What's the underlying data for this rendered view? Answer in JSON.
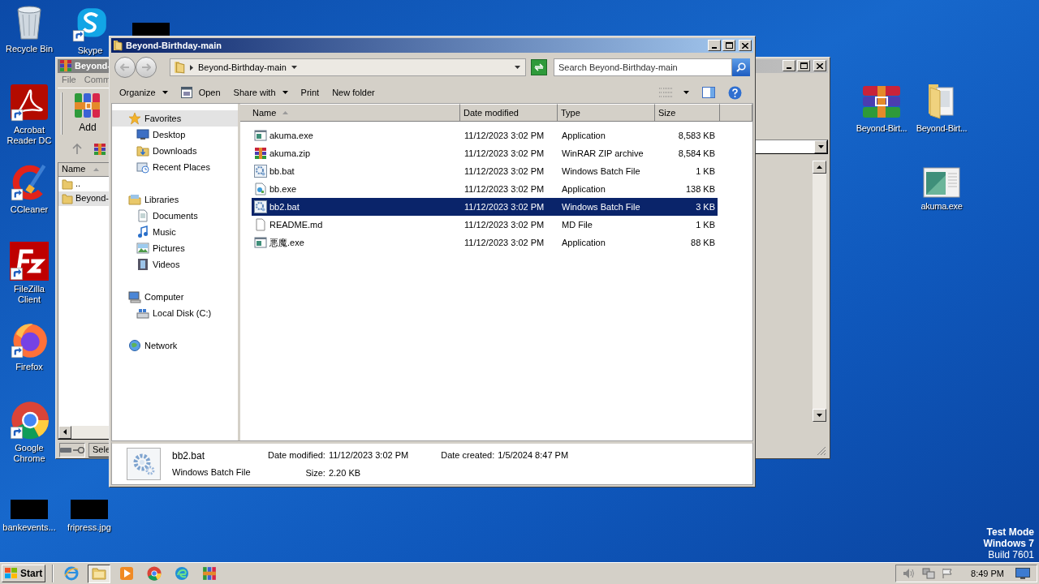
{
  "desktop_icons": [
    {
      "label": "Recycle Bin",
      "kind": "recycle"
    },
    {
      "label": "Skype",
      "kind": "skype"
    },
    {
      "kind": "redacted"
    },
    {
      "label": "Acrobat Reader DC",
      "kind": "acrobat"
    },
    {
      "label": "CCleaner",
      "kind": "ccleaner"
    },
    {
      "label": "FileZilla Client",
      "kind": "filezilla"
    },
    {
      "label": "Firefox",
      "kind": "firefox"
    },
    {
      "label": "Google Chrome",
      "kind": "chrome"
    },
    {
      "label": "bankevents...",
      "kind": "redacted"
    },
    {
      "label": "fripress.jpg",
      "kind": "redacted"
    },
    {
      "label": "Beyond-Birt...",
      "kind": "winrar"
    },
    {
      "label": "Beyond-Birt...",
      "kind": "folder"
    },
    {
      "label": "akuma.exe",
      "kind": "app"
    }
  ],
  "archive_window": {
    "title": "Beyond-",
    "menu": [
      "File",
      "Comm"
    ],
    "tool": "Add",
    "column": "Name",
    "rows": [
      {
        "name": "..",
        "selected": false
      },
      {
        "name": "Beyond-",
        "selected": true
      }
    ],
    "status": "Sele"
  },
  "explorer": {
    "title": "Beyond-Birthday-main",
    "breadcrumb": "Beyond-Birthday-main",
    "search": {
      "placeholder": "Search Beyond-Birthday-main"
    },
    "commands": [
      {
        "label": "Organize",
        "kind": "menu"
      },
      {
        "label": "Open",
        "kind": "icon"
      },
      {
        "label": "Share with",
        "kind": "menu"
      },
      {
        "label": "Print",
        "kind": "plain"
      },
      {
        "label": "New folder",
        "kind": "plain"
      }
    ],
    "nav": [
      {
        "label": "Favorites",
        "kind": "star",
        "selected": true,
        "children": [
          {
            "label": "Desktop",
            "kind": "desktop",
            "selected": false
          },
          {
            "label": "Downloads",
            "kind": "downloads",
            "selected": false
          },
          {
            "label": "Recent Places",
            "kind": "recent",
            "selected": false
          }
        ]
      },
      {
        "label": "Libraries",
        "kind": "library",
        "selected": false,
        "children": [
          {
            "label": "Documents",
            "kind": "documents",
            "selected": false
          },
          {
            "label": "Music",
            "kind": "music",
            "selected": false
          },
          {
            "label": "Pictures",
            "kind": "pictures",
            "selected": false
          },
          {
            "label": "Videos",
            "kind": "videos",
            "selected": false
          }
        ]
      },
      {
        "label": "Computer",
        "kind": "computer",
        "selected": false,
        "children": [
          {
            "label": "Local Disk (C:)",
            "kind": "disk",
            "selected": false
          }
        ]
      },
      {
        "label": "Network",
        "kind": "network",
        "selected": false
      }
    ],
    "columns": [
      {
        "label": "Name",
        "sorted": true
      },
      {
        "label": "Date modified",
        "sorted": false
      },
      {
        "label": "Type",
        "sorted": false
      },
      {
        "label": "Size",
        "sorted": false
      }
    ],
    "files": [
      {
        "name": "akuma.exe",
        "date": "11/12/2023 3:02 PM",
        "type": "Application",
        "size": "8,583 KB",
        "kind": "app",
        "selected": false
      },
      {
        "name": "akuma.zip",
        "date": "11/12/2023 3:02 PM",
        "type": "WinRAR ZIP archive",
        "size": "8,584 KB",
        "kind": "archive",
        "selected": false
      },
      {
        "name": "bb.bat",
        "date": "11/12/2023 3:02 PM",
        "type": "Windows Batch File",
        "size": "1 KB",
        "kind": "batch",
        "selected": false
      },
      {
        "name": "bb.exe",
        "date": "11/12/2023 3:02 PM",
        "type": "Application",
        "size": "138 KB",
        "kind": "installer",
        "selected": false
      },
      {
        "name": "bb2.bat",
        "date": "11/12/2023 3:02 PM",
        "type": "Windows Batch File",
        "size": "3 KB",
        "kind": "batch",
        "selected": true
      },
      {
        "name": "README.md",
        "date": "11/12/2023 3:02 PM",
        "type": "MD File",
        "size": "1 KB",
        "kind": "document",
        "selected": false
      },
      {
        "name": "悪魔.exe",
        "date": "11/12/2023 3:02 PM",
        "type": "Application",
        "size": "88 KB",
        "kind": "app",
        "selected": false
      }
    ],
    "details": {
      "name": "bb2.bat",
      "type": "Windows Batch File",
      "fields": [
        {
          "label": "Date modified:",
          "value": "11/12/2023 3:02 PM"
        },
        {
          "label": "Size:",
          "value": "2.20 KB"
        },
        {
          "label": "Date created:",
          "value": "1/5/2024 8:47 PM"
        }
      ]
    }
  },
  "desktop_notice": [
    {
      "text": "Test Mode",
      "bold": true
    },
    {
      "text": "Windows 7",
      "bold": true
    },
    {
      "text": "Build 7601",
      "bold": false
    }
  ],
  "taskbar": {
    "start": "Start",
    "apps": [
      {
        "kind": "ie",
        "selected": false
      },
      {
        "kind": "explorer",
        "selected": true
      },
      {
        "kind": "media",
        "selected": false
      },
      {
        "kind": "chrome",
        "selected": false
      },
      {
        "kind": "edge",
        "selected": false
      },
      {
        "kind": "winrar",
        "selected": false
      }
    ],
    "clock": "8:49 PM"
  }
}
